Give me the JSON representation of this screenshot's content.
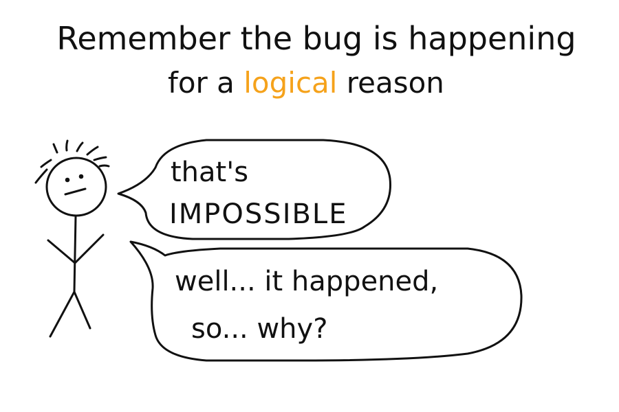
{
  "title": {
    "line1": "Remember the bug is happening",
    "line2_before": "for a ",
    "line2_highlight": "logical",
    "line2_after": " reason"
  },
  "bubble_top": {
    "line1": "that's",
    "line2": "IMPOSSIBLE"
  },
  "bubble_bottom": {
    "line1": "well... it happened,",
    "line2": "so... why?"
  },
  "colors": {
    "ink": "#111111",
    "highlight": "#f5a21b",
    "background": "#ffffff"
  }
}
